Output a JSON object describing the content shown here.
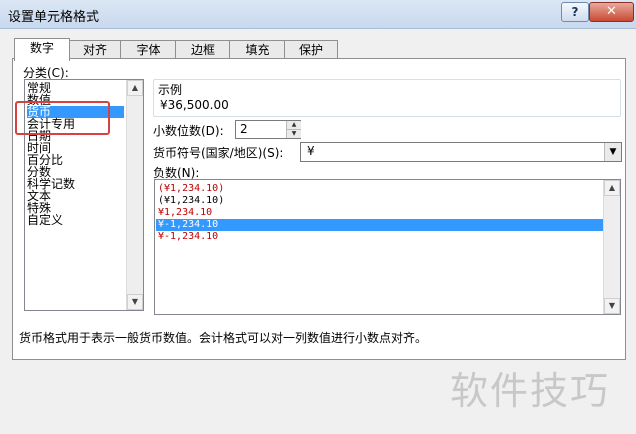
{
  "window": {
    "title": "设置单元格格式"
  },
  "titlebar": {
    "help_label": "?",
    "close_label": "✕"
  },
  "tabs": [
    {
      "label": "数字",
      "active": true
    },
    {
      "label": "对齐"
    },
    {
      "label": "字体"
    },
    {
      "label": "边框"
    },
    {
      "label": "填充"
    },
    {
      "label": "保护"
    }
  ],
  "category": {
    "label": "分类(C):",
    "items": [
      "常规",
      "数值",
      "货币",
      "会计专用",
      "日期",
      "时间",
      "百分比",
      "分数",
      "科学记数",
      "文本",
      "特殊",
      "自定义"
    ],
    "selected_index": 2
  },
  "sample": {
    "label": "示例",
    "value": "¥36,500.00"
  },
  "decimal": {
    "label": "小数位数(D):",
    "value": "2"
  },
  "currency_symbol": {
    "label": "货币符号(国家/地区)(S):",
    "value": "¥"
  },
  "negative": {
    "label": "负数(N):",
    "items": [
      {
        "text": "(¥1,234.10)",
        "red": true
      },
      {
        "text": "(¥1,234.10)",
        "red": false
      },
      {
        "text": "¥1,234.10",
        "red": true
      },
      {
        "text": "¥-1,234.10",
        "red": false,
        "selected": true
      },
      {
        "text": "¥-1,234.10",
        "red": true
      }
    ]
  },
  "description": "货币格式用于表示一般货币数值。会计格式可以对一列数值进行小数点对齐。",
  "watermark": "软件技巧",
  "colors": {
    "selection": "#3399ff",
    "negative_red": "#c00000",
    "highlight_box": "#d94040"
  },
  "icons": {
    "help": "question-icon",
    "close": "close-icon",
    "combo": "chevron-down-icon"
  }
}
